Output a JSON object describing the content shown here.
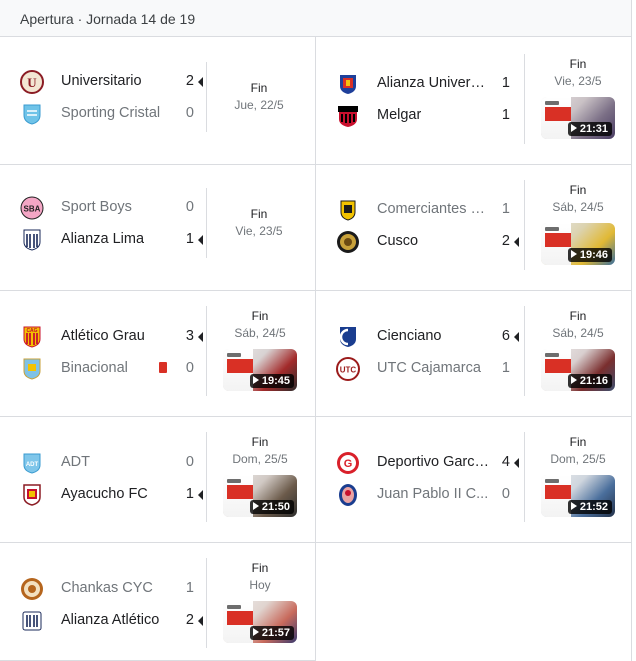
{
  "header": {
    "title": "Apertura · Jornada 14 de 19"
  },
  "matches": [
    {
      "home": {
        "name": "Universitario",
        "score": "2",
        "winner": true,
        "crest": "universitario-crest"
      },
      "away": {
        "name": "Sporting Cristal",
        "score": "0",
        "winner": false,
        "crest": "sporting-cristal-crest"
      },
      "status": "Fin",
      "date": "Jue, 22/5",
      "video": null
    },
    {
      "home": {
        "name": "Alianza Universidad",
        "display": "Alianza Universi...",
        "score": "1",
        "winner": false,
        "crest": "alianza-universidad-crest"
      },
      "away": {
        "name": "Melgar",
        "score": "1",
        "winner": false,
        "crest": "melgar-crest"
      },
      "status": "Fin",
      "date": "Vie, 23/5",
      "video": "21:31"
    },
    {
      "home": {
        "name": "Sport Boys",
        "score": "0",
        "winner": false,
        "crest": "sport-boys-crest"
      },
      "away": {
        "name": "Alianza Lima",
        "score": "1",
        "winner": true,
        "crest": "alianza-lima-crest"
      },
      "status": "Fin",
      "date": "Vie, 23/5",
      "video": null
    },
    {
      "home": {
        "name": "Comerciantes Unidos",
        "display": "Comerciantes U...",
        "score": "1",
        "winner": false,
        "crest": "comerciantes-unidos-crest"
      },
      "away": {
        "name": "Cusco",
        "score": "2",
        "winner": true,
        "crest": "cusco-crest"
      },
      "status": "Fin",
      "date": "Sáb, 24/5",
      "video": "19:46"
    },
    {
      "home": {
        "name": "Atlético Grau",
        "score": "3",
        "winner": true,
        "crest": "atletico-grau-crest"
      },
      "away": {
        "name": "Binacional",
        "score": "0",
        "winner": false,
        "crest": "binacional-crest",
        "red_card": true
      },
      "status": "Fin",
      "date": "Sáb, 24/5",
      "video": "19:45"
    },
    {
      "home": {
        "name": "Cienciano",
        "score": "6",
        "winner": true,
        "crest": "cienciano-crest"
      },
      "away": {
        "name": "UTC Cajamarca",
        "score": "1",
        "winner": false,
        "crest": "utc-cajamarca-crest"
      },
      "status": "Fin",
      "date": "Sáb, 24/5",
      "video": "21:16"
    },
    {
      "home": {
        "name": "ADT",
        "score": "0",
        "winner": false,
        "crest": "adt-crest"
      },
      "away": {
        "name": "Ayacucho FC",
        "score": "1",
        "winner": true,
        "crest": "ayacucho-fc-crest"
      },
      "status": "Fin",
      "date": "Dom, 25/5",
      "video": "21:50"
    },
    {
      "home": {
        "name": "Deportivo Garcilaso",
        "display": "Deportivo Garcil...",
        "score": "4",
        "winner": true,
        "crest": "deportivo-garcilaso-crest"
      },
      "away": {
        "name": "Juan Pablo II College",
        "display": "Juan Pablo II C...",
        "score": "0",
        "winner": false,
        "crest": "juan-pablo-ii-crest"
      },
      "status": "Fin",
      "date": "Dom, 25/5",
      "video": "21:52"
    },
    {
      "home": {
        "name": "Chankas CYC",
        "score": "1",
        "winner": false,
        "crest": "chankas-cyc-crest"
      },
      "away": {
        "name": "Alianza Atlético",
        "score": "2",
        "winner": true,
        "crest": "alianza-atletico-crest"
      },
      "status": "Fin",
      "date": "Hoy",
      "video": "21:57"
    }
  ],
  "colors": {
    "divider": "#dadce0",
    "header_bg": "#f8f9fa",
    "winner_text": "#202124",
    "loser_text": "#70757a",
    "red_card": "#d93025"
  }
}
